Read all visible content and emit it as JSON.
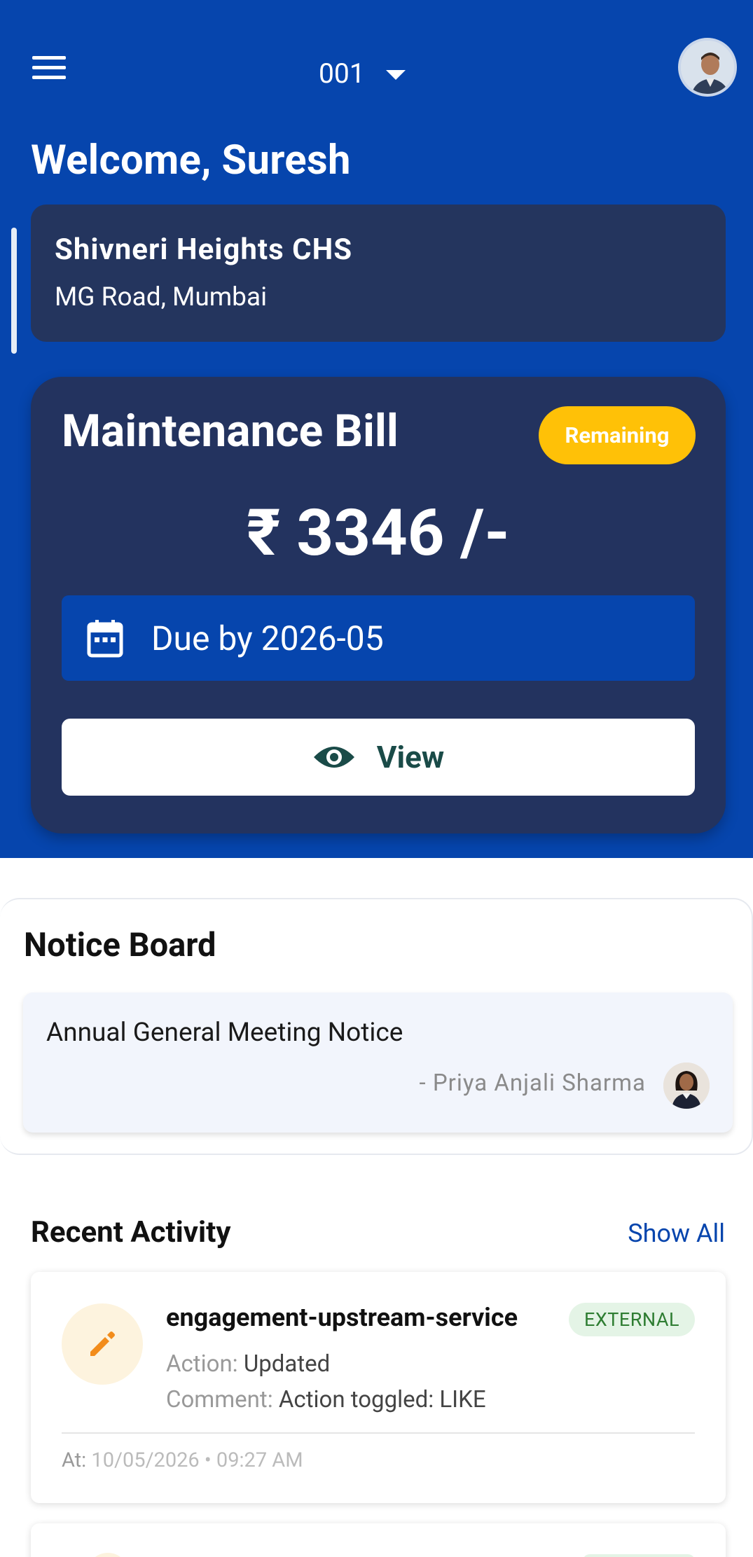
{
  "header": {
    "unit": "001",
    "welcome": "Welcome, Suresh"
  },
  "society": {
    "name": "Shivneri Heights CHS",
    "address": "MG Road, Mumbai"
  },
  "bill": {
    "title": "Maintenance Bill",
    "status": "Remaining",
    "amount": "₹ 3346 /-",
    "due": "Due by 2026-05",
    "view_label": "View",
    "status_color": "#ffc107"
  },
  "notice_board": {
    "title": "Notice Board",
    "items": [
      {
        "text": "Annual General Meeting Notice",
        "author": "- Priya Anjali Sharma"
      }
    ]
  },
  "recent_activity": {
    "title": "Recent Activity",
    "show_all": "Show All",
    "items": [
      {
        "title": "engagement-upstream-service",
        "badge": "EXTERNAL",
        "action_label": "Action:",
        "action_value": "Updated",
        "comment_label": "Comment:",
        "comment_value": "Action toggled: LIKE",
        "at_label": "At:",
        "at_value": "10/05/2026 • 09:27 AM",
        "icon": "pencil-icon"
      }
    ]
  },
  "colors": {
    "primary": "#0645ad",
    "card_dark": "#23335f",
    "accent_orange": "#f28c1b"
  }
}
